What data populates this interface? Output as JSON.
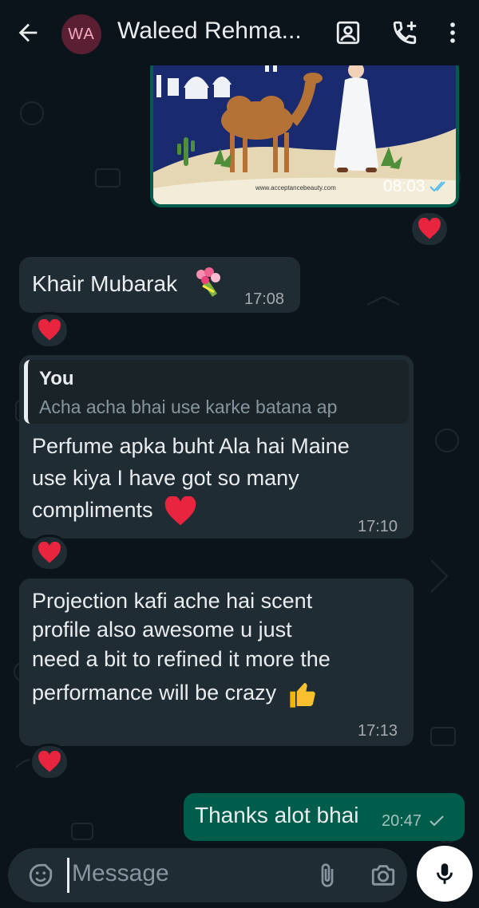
{
  "header": {
    "avatar_initials": "WA",
    "contact_name": "Waleed Rehma...",
    "icons": [
      "back-arrow-icon",
      "video-call-icon",
      "add-call-icon",
      "more-vert-icon"
    ]
  },
  "messages": [
    {
      "direction": "out",
      "type": "image",
      "image_caption_url": "www.acceptancebeauty.com",
      "time": "08:03",
      "status": "read",
      "reaction": "heart"
    },
    {
      "direction": "in",
      "text": "Khair Mubarak",
      "emoji": "bouquet",
      "time": "17:08",
      "reaction": "heart"
    },
    {
      "direction": "in",
      "quote_author": "You",
      "quote_text": "Acha acha bhai use karke batana ap",
      "lines": [
        "Perfume apka buht Ala hai Maine",
        "use kiya I have got so many",
        "compliments"
      ],
      "emoji": "heart",
      "time": "17:10",
      "reaction": "heart"
    },
    {
      "direction": "in",
      "lines": [
        "Projection kafi ache hai scent",
        "profile also awesome u just",
        "need a bit to refined it more the",
        "performance will be crazy"
      ],
      "emoji": "thumbs-up",
      "time": "17:13",
      "reaction": "heart"
    },
    {
      "direction": "out",
      "text": "Thanks alot bhai",
      "time": "20:47",
      "status": "sent"
    }
  ],
  "input": {
    "placeholder": "Message"
  },
  "colors": {
    "bg": "#0b141a",
    "incoming": "#202c33",
    "outgoing": "#005c4b",
    "heart": "#e8243f"
  }
}
